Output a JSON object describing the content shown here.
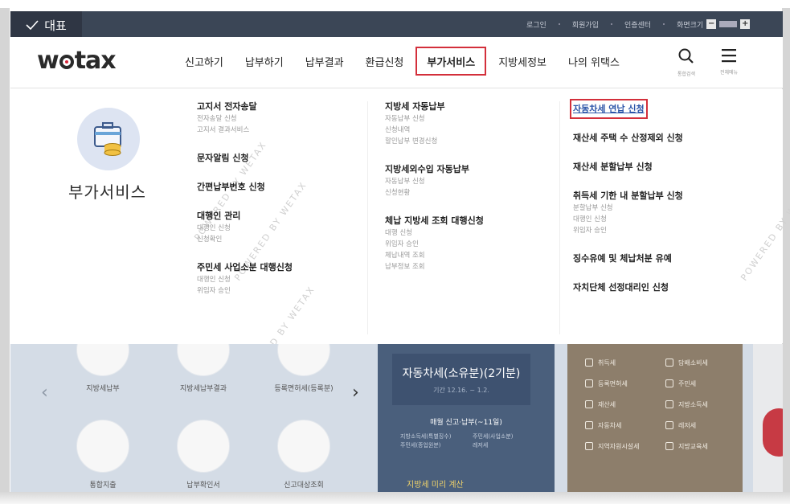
{
  "badge": {
    "label": "대표"
  },
  "util": {
    "links": [
      "로그인",
      "회원가입",
      "인증센터"
    ],
    "zoom_label": "화면크기"
  },
  "header": {
    "logo": "wetax",
    "nav": [
      "신고하기",
      "납부하기",
      "납부결과",
      "환급신청",
      "부가서비스",
      "지방세정보",
      "나의 위택스"
    ],
    "active_nav": "부가서비스",
    "search_caption": "통합검색",
    "menu_caption": "전체메뉴"
  },
  "mega": {
    "category": "부가서비스",
    "col1": [
      {
        "title": "고지서 전자송달",
        "items": [
          "전자송달 신청",
          "고지서 결과서비스"
        ]
      },
      {
        "title": "문자알림 신청",
        "items": []
      },
      {
        "title": "간편납부번호 신청",
        "items": []
      },
      {
        "title": "대행인 관리",
        "items": [
          "대행인 신청",
          "신청확인"
        ]
      },
      {
        "title": "주민세 사업소분 대행신청",
        "items": [
          "대행인 신청",
          "위임자 승인"
        ]
      }
    ],
    "col2": [
      {
        "title": "지방세 자동납부",
        "items": [
          "자동납부 신청",
          "신청내역",
          "할인납부 변경신청"
        ]
      },
      {
        "title": "지방세외수입 자동납부",
        "items": [
          "자동납부 신청",
          "신청현황"
        ]
      },
      {
        "title": "체납 지방세 조회 대행신청",
        "items": [
          "대행 신청",
          "위임자 승인",
          "체납내역 조회",
          "납부정보 조회"
        ]
      }
    ],
    "col3": [
      {
        "title": "자동차세 연납 신청",
        "items": [],
        "highlight": true
      },
      {
        "title": "재산세 주택 수 산정제외 신청",
        "items": []
      },
      {
        "title": "재산세 분할납부 신청",
        "items": []
      },
      {
        "title": "취득세 기한 내 분할납부 신청",
        "items": [
          "분할납부 신청",
          "대행인 신청",
          "위임자 승인"
        ]
      },
      {
        "title": "징수유예 및 체납처분 유예",
        "items": []
      },
      {
        "title": "자치단체 선정대리인 신청",
        "items": []
      }
    ],
    "watermark": "POWERED BY WETAX"
  },
  "lower": {
    "services_row1": [
      "지방세납부",
      "지방세납부결과",
      "등록면허세(등록분)"
    ],
    "services_row2": [
      "통합지출",
      "납부확인서",
      "신고대상조회"
    ],
    "promo_title": "자동차세(소유분)(2기분)",
    "promo_date": "기간 12.16. ~ 1.2.",
    "promo_sub": "매월 신고·납부(~11일)",
    "promo_left": "지방소득세(특별징수)\n주민세(종업원분)",
    "promo_right": "주민세(사업소분)\n레저세",
    "promo_bottom": "지방세 미리 계산",
    "tax_items": [
      "취득세",
      "등록면허세",
      "재산세",
      "자동차세",
      "지역자원시설세",
      "레저세",
      "주민세",
      "담배소비세",
      "지방소득세",
      "지방교육세"
    ]
  }
}
